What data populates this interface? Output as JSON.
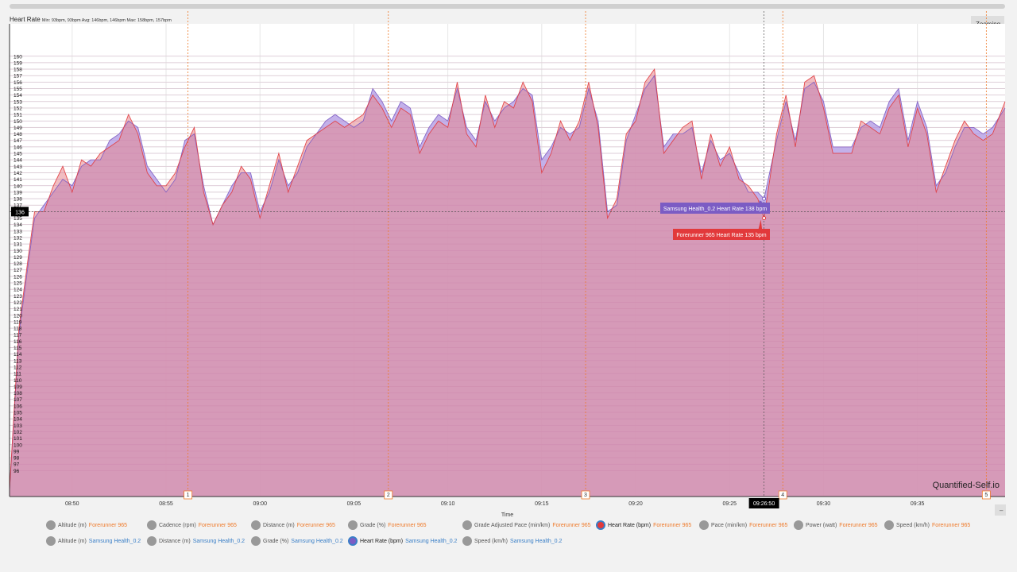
{
  "header": {
    "title": "Heart Rate",
    "stats": "Min: 93bpm, 93bpm Avg: 146bpm, 146bpm Max: 158bpm, 157bpm"
  },
  "controls": {
    "zoom_label": "Zooming",
    "minus_label": "–"
  },
  "colors": {
    "forerunner": "#ef7a2a",
    "samsung": "#3a7fc7",
    "fill_red": "#e5868e",
    "fill_purple": "#b9a3e6",
    "tooltip_purple": "#7b5cc4",
    "tooltip_red": "#e2393b"
  },
  "chart_data": {
    "type": "area",
    "title": "Heart Rate",
    "xlabel": "Time",
    "ylabel": "",
    "x_ticks": [
      "08:50",
      "08:55",
      "09:00",
      "09:05",
      "09:10",
      "09:15",
      "09:20",
      "09:25",
      "09:30",
      "09:35"
    ],
    "y_ticks": [
      96,
      97,
      98,
      99,
      100,
      101,
      102,
      103,
      104,
      105,
      106,
      107,
      108,
      109,
      110,
      111,
      112,
      113,
      114,
      115,
      116,
      117,
      118,
      119,
      120,
      121,
      122,
      123,
      124,
      125,
      126,
      127,
      128,
      129,
      130,
      131,
      132,
      133,
      134,
      135,
      136,
      137,
      138,
      139,
      140,
      141,
      142,
      143,
      144,
      145,
      146,
      147,
      148,
      149,
      150,
      151,
      152,
      153,
      154,
      155,
      156,
      157,
      158,
      159,
      160
    ],
    "xlim": [
      "08:46:40",
      "09:39:40"
    ],
    "ylim": [
      92,
      165
    ],
    "laps": [
      {
        "label": "1",
        "time": "08:56:10"
      },
      {
        "label": "2",
        "time": "09:06:50"
      },
      {
        "label": "3",
        "time": "09:17:20"
      },
      {
        "label": "4",
        "time": "09:27:50"
      },
      {
        "label": "5",
        "time": "09:38:40"
      }
    ],
    "crosshair": {
      "time": "09:26:50",
      "value": 136
    },
    "series": [
      {
        "name": "Forerunner 965 Heart Rate",
        "unit": "bpm",
        "x": [
          "08:46:40",
          "08:47:10",
          "08:47:40",
          "08:48:00",
          "08:48:30",
          "08:49:00",
          "08:49:30",
          "08:50:00",
          "08:50:30",
          "08:51:00",
          "08:51:30",
          "08:52:00",
          "08:52:30",
          "08:53:00",
          "08:53:30",
          "08:54:00",
          "08:54:30",
          "08:55:00",
          "08:55:30",
          "08:56:00",
          "08:56:30",
          "08:57:00",
          "08:57:30",
          "08:58:00",
          "08:58:30",
          "08:59:00",
          "08:59:30",
          "09:00:00",
          "09:00:30",
          "09:01:00",
          "09:01:30",
          "09:02:00",
          "09:02:30",
          "09:03:00",
          "09:03:30",
          "09:04:00",
          "09:04:30",
          "09:05:00",
          "09:05:30",
          "09:06:00",
          "09:06:30",
          "09:07:00",
          "09:07:30",
          "09:08:00",
          "09:08:30",
          "09:09:00",
          "09:09:30",
          "09:10:00",
          "09:10:30",
          "09:11:00",
          "09:11:30",
          "09:12:00",
          "09:12:30",
          "09:13:00",
          "09:13:30",
          "09:14:00",
          "09:14:30",
          "09:15:00",
          "09:15:30",
          "09:16:00",
          "09:16:30",
          "09:17:00",
          "09:17:30",
          "09:18:00",
          "09:18:30",
          "09:19:00",
          "09:19:30",
          "09:20:00",
          "09:20:30",
          "09:21:00",
          "09:21:30",
          "09:22:00",
          "09:22:30",
          "09:23:00",
          "09:23:30",
          "09:24:00",
          "09:24:30",
          "09:25:00",
          "09:25:30",
          "09:26:00",
          "09:26:30",
          "09:26:50",
          "09:27:30",
          "09:28:00",
          "09:28:30",
          "09:29:00",
          "09:29:30",
          "09:30:00",
          "09:30:30",
          "09:31:00",
          "09:31:30",
          "09:32:00",
          "09:32:30",
          "09:33:00",
          "09:33:30",
          "09:34:00",
          "09:34:30",
          "09:35:00",
          "09:35:30",
          "09:36:00",
          "09:36:30",
          "09:37:00",
          "09:37:30",
          "09:38:00",
          "09:38:30",
          "09:39:00",
          "09:39:40"
        ],
        "y": [
          93,
          118,
          129,
          136,
          136,
          140,
          143,
          139,
          144,
          143,
          145,
          146,
          147,
          151,
          148,
          142,
          140,
          140,
          142,
          146,
          149,
          139,
          134,
          137,
          139,
          143,
          141,
          135,
          140,
          145,
          139,
          143,
          147,
          148,
          149,
          150,
          149,
          150,
          151,
          154,
          152,
          149,
          152,
          151,
          145,
          148,
          150,
          149,
          156,
          148,
          146,
          154,
          149,
          153,
          152,
          156,
          153,
          142,
          145,
          150,
          147,
          150,
          156,
          149,
          135,
          138,
          148,
          150,
          156,
          158,
          145,
          147,
          149,
          150,
          141,
          148,
          143,
          146,
          141,
          140,
          138,
          135,
          148,
          154,
          146,
          156,
          157,
          152,
          145,
          145,
          145,
          150,
          149,
          148,
          152,
          154,
          146,
          152,
          148,
          139,
          143,
          147,
          150,
          148,
          147,
          148,
          153
        ],
        "color": "#e2393b"
      },
      {
        "name": "Samsung Health_0.2 Heart Rate",
        "unit": "bpm",
        "x": [
          "08:46:40",
          "08:47:10",
          "08:47:40",
          "08:48:00",
          "08:48:30",
          "08:49:00",
          "08:49:30",
          "08:50:00",
          "08:50:30",
          "08:51:00",
          "08:51:30",
          "08:52:00",
          "08:52:30",
          "08:53:00",
          "08:53:30",
          "08:54:00",
          "08:54:30",
          "08:55:00",
          "08:55:30",
          "08:56:00",
          "08:56:30",
          "08:57:00",
          "08:57:30",
          "08:58:00",
          "08:58:30",
          "08:59:00",
          "08:59:30",
          "09:00:00",
          "09:00:30",
          "09:01:00",
          "09:01:30",
          "09:02:00",
          "09:02:30",
          "09:03:00",
          "09:03:30",
          "09:04:00",
          "09:04:30",
          "09:05:00",
          "09:05:30",
          "09:06:00",
          "09:06:30",
          "09:07:00",
          "09:07:30",
          "09:08:00",
          "09:08:30",
          "09:09:00",
          "09:09:30",
          "09:10:00",
          "09:10:30",
          "09:11:00",
          "09:11:30",
          "09:12:00",
          "09:12:30",
          "09:13:00",
          "09:13:30",
          "09:14:00",
          "09:14:30",
          "09:15:00",
          "09:15:30",
          "09:16:00",
          "09:16:30",
          "09:17:00",
          "09:17:30",
          "09:18:00",
          "09:18:30",
          "09:19:00",
          "09:19:30",
          "09:20:00",
          "09:20:30",
          "09:21:00",
          "09:21:30",
          "09:22:00",
          "09:22:30",
          "09:23:00",
          "09:23:30",
          "09:24:00",
          "09:24:30",
          "09:25:00",
          "09:25:30",
          "09:26:00",
          "09:26:30",
          "09:26:50",
          "09:27:30",
          "09:28:00",
          "09:28:30",
          "09:29:00",
          "09:29:30",
          "09:30:00",
          "09:30:30",
          "09:31:00",
          "09:31:30",
          "09:32:00",
          "09:32:30",
          "09:33:00",
          "09:33:30",
          "09:34:00",
          "09:34:30",
          "09:35:00",
          "09:35:30",
          "09:36:00",
          "09:36:30",
          "09:37:00",
          "09:37:30",
          "09:38:00",
          "09:38:30",
          "09:39:00",
          "09:39:40"
        ],
        "y": [
          93,
          117,
          128,
          135,
          137,
          139,
          141,
          140,
          143,
          144,
          144,
          147,
          148,
          150,
          149,
          143,
          141,
          139,
          141,
          147,
          148,
          140,
          134,
          137,
          140,
          142,
          142,
          136,
          139,
          144,
          140,
          142,
          146,
          148,
          150,
          151,
          150,
          149,
          150,
          155,
          153,
          150,
          153,
          152,
          146,
          149,
          151,
          150,
          155,
          149,
          147,
          153,
          150,
          152,
          153,
          155,
          154,
          144,
          146,
          149,
          148,
          149,
          155,
          150,
          136,
          137,
          147,
          151,
          155,
          157,
          146,
          148,
          148,
          149,
          142,
          147,
          144,
          145,
          142,
          139,
          139,
          138,
          147,
          153,
          147,
          155,
          156,
          153,
          146,
          146,
          146,
          149,
          150,
          149,
          153,
          155,
          147,
          153,
          149,
          140,
          142,
          146,
          149,
          149,
          148,
          149,
          152
        ],
        "color": "#7b5cc4"
      }
    ]
  },
  "tooltips": {
    "samsung": "Samsung Health_0.2 Heart Rate 138 bpm",
    "forerunner": "Forerunner 965 Heart Rate 135 bpm",
    "y_flag": "136",
    "x_flag": "09:26:50"
  },
  "watermark": "Quantified-Self.io",
  "legend": {
    "row1": [
      {
        "name": "Altitude (m)",
        "source": "Forerunner 965",
        "active": false
      },
      {
        "name": "Cadence (rpm)",
        "source": "Forerunner 965",
        "active": false
      },
      {
        "name": "Distance (m)",
        "source": "Forerunner 965",
        "active": false
      },
      {
        "name": "Grade (%)",
        "source": "Forerunner 965",
        "active": false
      },
      {
        "name": "Grade Adjusted Pace (min/km)",
        "source": "Forerunner 965",
        "active": false
      },
      {
        "name": "Heart Rate (bpm)",
        "source": "Forerunner 965",
        "active": true
      },
      {
        "name": "Pace (min/km)",
        "source": "Forerunner 965",
        "active": false
      },
      {
        "name": "Power (watt)",
        "source": "Forerunner 965",
        "active": false
      },
      {
        "name": "Speed (km/h)",
        "source": "Forerunner 965",
        "active": false
      }
    ],
    "row2": [
      {
        "name": "Altitude (m)",
        "source": "Samsung Health_0.2",
        "active": false
      },
      {
        "name": "Distance (m)",
        "source": "Samsung Health_0.2",
        "active": false
      },
      {
        "name": "Grade (%)",
        "source": "Samsung Health_0.2",
        "active": false
      },
      {
        "name": "Heart Rate (bpm)",
        "source": "Samsung Health_0.2",
        "active": true
      },
      {
        "name": "Speed (km/h)",
        "source": "Samsung Health_0.2",
        "active": false
      }
    ]
  }
}
